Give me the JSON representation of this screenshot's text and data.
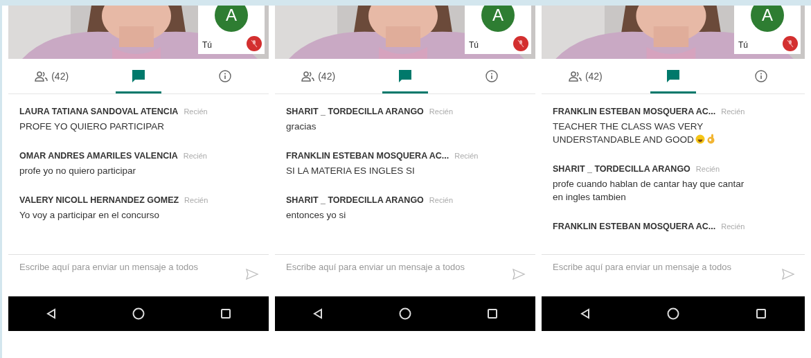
{
  "screens": [
    {
      "self_tile": {
        "initial": "A",
        "label": "Tú",
        "muted": true
      },
      "tabs": [
        {
          "kind": "people",
          "label": "(42)",
          "selected": false
        },
        {
          "kind": "chat",
          "selected": true
        },
        {
          "kind": "info",
          "selected": false
        }
      ],
      "messages": [
        {
          "sender": "LAURA TATIANA SANDOVAL ATENCIA",
          "time": "Recién",
          "text": "PROFE YO QUIERO PARTICIPAR"
        },
        {
          "sender": "OMAR ANDRES AMARILES VALENCIA",
          "time": "Recién",
          "text": "profe yo no quiero participar"
        },
        {
          "sender": "VALERY NICOLL HERNANDEZ GOMEZ",
          "time": "Recién",
          "text": "Yo voy  a participar en el concurso"
        }
      ],
      "composer": {
        "placeholder": "Escribe aquí para enviar un mensaje a todos"
      }
    },
    {
      "self_tile": {
        "initial": "A",
        "label": "Tú",
        "muted": true
      },
      "tabs": [
        {
          "kind": "people",
          "label": "(42)",
          "selected": false
        },
        {
          "kind": "chat",
          "selected": true
        },
        {
          "kind": "info",
          "selected": false
        }
      ],
      "messages": [
        {
          "sender": "SHARIT _ TORDECILLA ARANGO",
          "time": "Recién",
          "text": "gracias"
        },
        {
          "sender": "FRANKLIN ESTEBAN MOSQUERA AC...",
          "time": "Recién",
          "text": "SI LA MATERIA ES INGLES SI"
        },
        {
          "sender": "SHARIT _ TORDECILLA ARANGO",
          "time": "Recién",
          "text": "entonces yo si"
        }
      ],
      "composer": {
        "placeholder": "Escribe aquí para enviar un mensaje a todos"
      }
    },
    {
      "self_tile": {
        "initial": "A",
        "label": "Tú",
        "muted": true
      },
      "tabs": [
        {
          "kind": "people",
          "label": "(42)",
          "selected": false
        },
        {
          "kind": "chat",
          "selected": true
        },
        {
          "kind": "info",
          "selected": false
        }
      ],
      "messages": [
        {
          "sender": "FRANKLIN ESTEBAN MOSQUERA AC...",
          "time": "Recién",
          "text": "TEACHER THE CLASS WAS VERY UNDERSTANDABLE AND GOOD",
          "emoji": true
        },
        {
          "sender": "SHARIT _ TORDECILLA ARANGO",
          "time": "Recién",
          "text": " profe cuando hablan de cantar hay que cantar en ingles tambien"
        },
        {
          "sender": "FRANKLIN ESTEBAN MOSQUERA AC...",
          "time": "Recién"
        }
      ],
      "composer": {
        "placeholder": "Escribe aquí para enviar un mensaje a todos"
      }
    }
  ]
}
